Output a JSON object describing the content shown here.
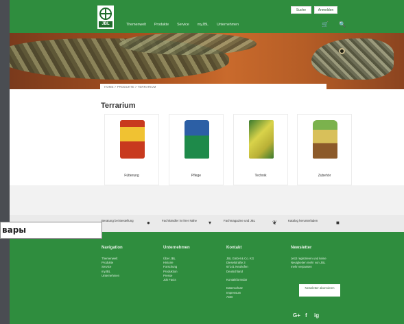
{
  "header": {
    "logo_text": "JBL",
    "util_search": "Suche",
    "util_login": "Anmelden",
    "nav": [
      "Themenwelt",
      "Produkte",
      "Service",
      "myJBL",
      "Unternehmen"
    ],
    "cart_icon": "cart-icon",
    "search_icon": "search-icon"
  },
  "breadcrumb": "HOME  >  PRODUKTE  >  TERRARIUM",
  "page_title": "Terrarium",
  "categories": [
    {
      "label": "Fütterung"
    },
    {
      "label": "Pflege"
    },
    {
      "label": "Technik"
    },
    {
      "label": "Zubehör"
    }
  ],
  "strip": [
    {
      "text": "Beratung bei Bestellung",
      "icon": "chat-icon"
    },
    {
      "text": "Fachhändler in Ihrer Nähe",
      "icon": "location-icon"
    },
    {
      "text": "Fachmagazine und JBL",
      "icon": "leaf-icon"
    },
    {
      "text": "Katalog herunterladen",
      "icon": "document-icon"
    }
  ],
  "footer": {
    "nav_title": "Navigation",
    "nav_items": [
      "Themenwelt",
      "Produkte",
      "Service",
      "myJBL",
      "Unternehmen"
    ],
    "company_title": "Unternehmen",
    "company_items": [
      "Über JBL",
      "Historie",
      "Forschung",
      "Produktion",
      "Presse",
      "Job Facts"
    ],
    "contact_title": "Kontakt",
    "contact_items": [
      "JBL GmbH & Co. KG",
      "Dieselstraße 3",
      "67141 Neuhofen",
      "Deutschland",
      "",
      "Kontaktformular",
      "",
      "Datenschutz",
      "Impressum",
      "AGB"
    ],
    "newsletter_title": "Newsletter",
    "newsletter_text": [
      "Jetzt registrieren und keine",
      "Neuigkeiten mehr von JBL",
      "mehr verpassen"
    ],
    "newsletter_button": "Newsletter abonnieren",
    "social": [
      "G+",
      "f",
      "ig"
    ]
  },
  "overlay_label": "вары"
}
